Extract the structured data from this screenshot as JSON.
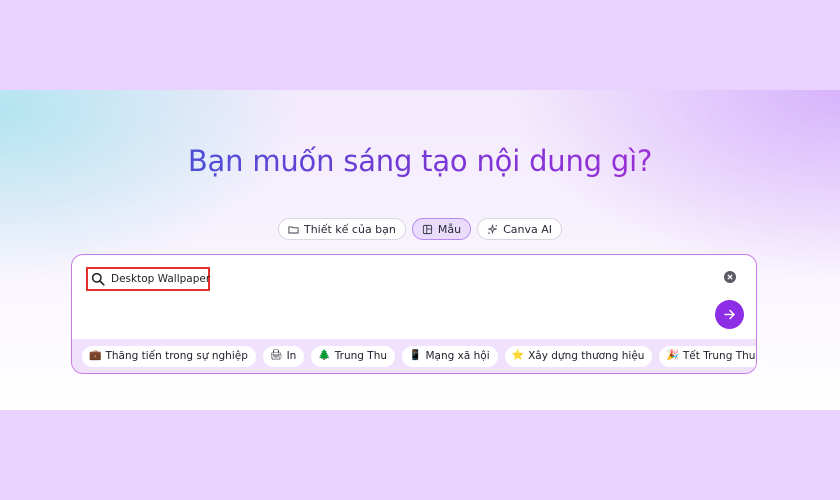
{
  "hero": {
    "title": "Bạn muốn sáng tạo nội dung gì?"
  },
  "tabs": [
    {
      "label": "Thiết kế của bạn",
      "icon": "folder-icon",
      "active": false
    },
    {
      "label": "Mẫu",
      "icon": "template-icon",
      "active": true
    },
    {
      "label": "Canva AI",
      "icon": "sparkle-icon",
      "active": false
    }
  ],
  "search": {
    "value": "Desktop Wallpaper",
    "icon": "search-icon",
    "highlight_color": "#e2312d"
  },
  "submit": {
    "icon": "arrow-right-icon",
    "color": "#8d2ee6"
  },
  "chips": [
    {
      "label": "Thăng tiến trong sự nghiệp",
      "icon": "briefcase-icon",
      "glyph": "💼"
    },
    {
      "label": "In",
      "icon": "printer-icon",
      "glyph": "🖨"
    },
    {
      "label": "Trung Thu",
      "icon": "tree-icon",
      "glyph": "🌲"
    },
    {
      "label": "Mạng xã hội",
      "icon": "phone-icon",
      "glyph": "📱"
    },
    {
      "label": "Xây dựng thương hiệu",
      "icon": "star-icon",
      "glyph": "⭐"
    },
    {
      "label": "Tết Trung Thu",
      "icon": "party-popper-icon",
      "glyph": "🎉"
    }
  ]
}
